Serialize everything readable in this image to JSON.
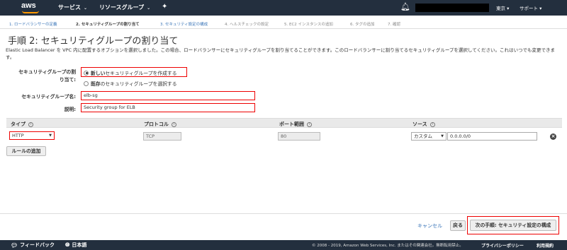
{
  "topnav": {
    "logo": "aws",
    "services": "サービス",
    "resource_groups": "リソースグループ",
    "region": "東京",
    "support": "サポート",
    "icons": [
      "pin-icon",
      "bell-icon"
    ]
  },
  "steps": [
    {
      "label": "1. ロードバランサーの定義",
      "state": "link"
    },
    {
      "label": "2. セキュリティグループの割り当て",
      "state": "active"
    },
    {
      "label": "3. セキュリティ設定の構成",
      "state": "link"
    },
    {
      "label": "4. ヘルスチェックの設定",
      "state": "disabled"
    },
    {
      "label": "5. EC2 インスタンスの追加",
      "state": "disabled"
    },
    {
      "label": "6. タグの追加",
      "state": "disabled"
    },
    {
      "label": "7. 確認",
      "state": "disabled"
    }
  ],
  "page": {
    "title": "手順 2: セキュリティグループの割り当て",
    "description": "Elastic Load Balancer を VPC 内に配置するオプションを選択しました。この場合、ロードバランサーにセキュリティグループを割り当てることができます。このロードバランサーに割り当てるセキュリティグループを選択してください。これはいつでも変更できます。"
  },
  "form": {
    "assign_label_line1": "セキュリティグループの割",
    "assign_label_line2": "り当て:",
    "option_new_bold": "新しい",
    "option_new_rest": "セキュリティグループを作成する",
    "option_existing_bold": "既存",
    "option_existing_rest": "のセキュリティグループを選択する",
    "name_label": "セキュリティグループ名:",
    "name_value": "elb-sg",
    "desc_label": "説明:",
    "desc_value": "Security group for ELB"
  },
  "rules_table": {
    "headers": [
      "タイプ",
      "プロトコル",
      "ポート範囲",
      "ソース"
    ],
    "rows": [
      {
        "type": "HTTP",
        "protocol": "TCP",
        "port": "80",
        "source_type": "カスタム",
        "source": "0.0.0.0/0"
      }
    ],
    "add_rule": "ルールの追加"
  },
  "actions": {
    "cancel": "キャンセル",
    "previous": "戻る",
    "next": "次の手順: セキュリティ設定の構成"
  },
  "footer": {
    "feedback": "フィードバック",
    "language": "日本語",
    "copyright": "© 2008 - 2019, Amazon Web Services, Inc. またはその関連会社。無断転用禁止。",
    "privacy": "プライバシーポリシー",
    "terms": "利用規約"
  },
  "colors": {
    "nav_bg": "#232f3e",
    "highlight": "#ee0000",
    "link": "#3a75b8",
    "logo_accent": "#ff9900"
  }
}
